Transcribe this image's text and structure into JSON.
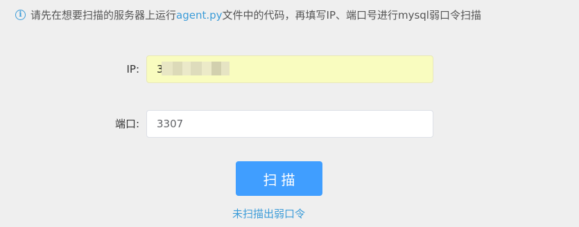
{
  "notice": {
    "icon": "info-icon",
    "text_before": "请先在想要扫描的服务器上运行",
    "link_text": "agent.py",
    "text_after": "文件中的代码，再填写IP、端口号进行mysql弱口令扫描"
  },
  "form": {
    "ip_label": "IP:",
    "ip_value": "3",
    "port_label": "端口:",
    "port_value": "3307"
  },
  "scan_button": "扫描",
  "result_text": "未扫描出弱口令",
  "colors": {
    "accent": "#409eff",
    "link": "#3a9bd8",
    "autofill_bg": "#f9fcbf",
    "page_bg": "#efefef"
  }
}
